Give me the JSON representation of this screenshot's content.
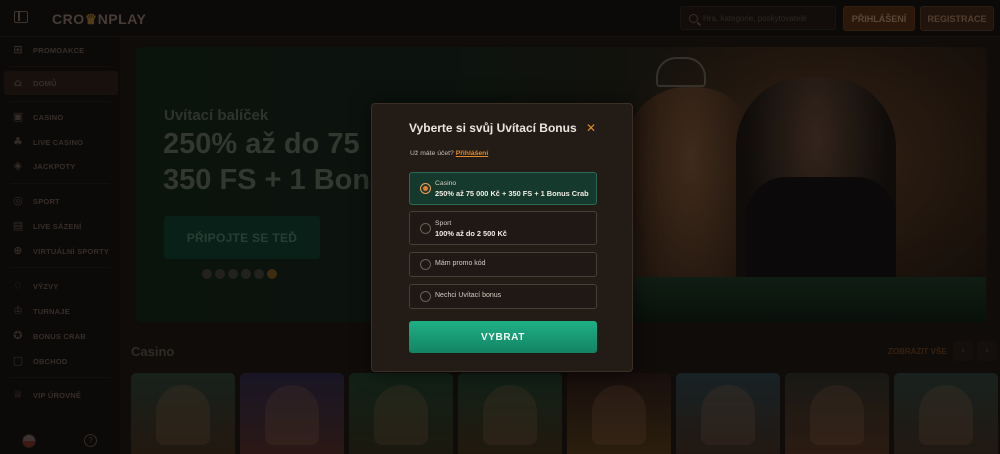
{
  "header": {
    "logo_left": "CRO",
    "logo_crown": "♛",
    "logo_right": "NPLAY",
    "search_placeholder": "Hra, kategorie, poskytovatelé",
    "login_label": "PŘIHLÁŠENÍ",
    "register_label": "REGISTRACE"
  },
  "sidebar": {
    "items": [
      {
        "label": "PROMOAKCE",
        "icon": "gift-icon"
      },
      {
        "label": "DOMŮ",
        "icon": "home-icon"
      },
      {
        "label": "CASINO",
        "icon": "casino-icon"
      },
      {
        "label": "LIVE CASINO",
        "icon": "live-casino-icon"
      },
      {
        "label": "JACKPOTY",
        "icon": "jackpot-icon"
      },
      {
        "label": "SPORT",
        "icon": "sport-icon"
      },
      {
        "label": "LIVE SÁZENÍ",
        "icon": "live-betting-icon"
      },
      {
        "label": "VIRTUÁLNÍ SPORTY",
        "icon": "virtual-sports-icon"
      },
      {
        "label": "VÝZVY",
        "icon": "challenges-icon"
      },
      {
        "label": "TURNAJE",
        "icon": "trophy-icon"
      },
      {
        "label": "BONUS CRAB",
        "icon": "crab-icon"
      },
      {
        "label": "OBCHOD",
        "icon": "shop-icon"
      },
      {
        "label": "VIP ÚROVNĚ",
        "icon": "vip-icon"
      }
    ],
    "active": "DOMŮ"
  },
  "banner": {
    "subtitle": "Uvítací balíček",
    "title_line1": "250% až do 75",
    "title_line2": "350 FS + 1 Bon",
    "cta_label": "PŘIPOJTE SE TEĎ"
  },
  "casino_section": {
    "title": "Casino",
    "view_all": "ZOBRAZIT VŠE",
    "prev": "‹",
    "next": "›"
  },
  "modal": {
    "title": "Vyberte si svůj Uvítací Bonus",
    "close": "✕",
    "login_prompt": "Už máte účet?",
    "login_link": "Přihlášení",
    "options": [
      {
        "label": "Casino",
        "detail": "250% až 75 000 Kč + 350 FS + 1 Bonus Crab",
        "selected": true
      },
      {
        "label": "Sport",
        "detail": "100% až do 2 500 Kč",
        "selected": false
      },
      {
        "label": "Mám promo kód",
        "detail": "",
        "selected": false
      },
      {
        "label": "Nechci Uvítací bonus",
        "detail": "",
        "selected": false
      }
    ],
    "submit_label": "VYBRAT"
  },
  "colors": {
    "accent_orange": "#e08a2a",
    "accent_green": "#1fb085",
    "background": "#1d1612"
  }
}
